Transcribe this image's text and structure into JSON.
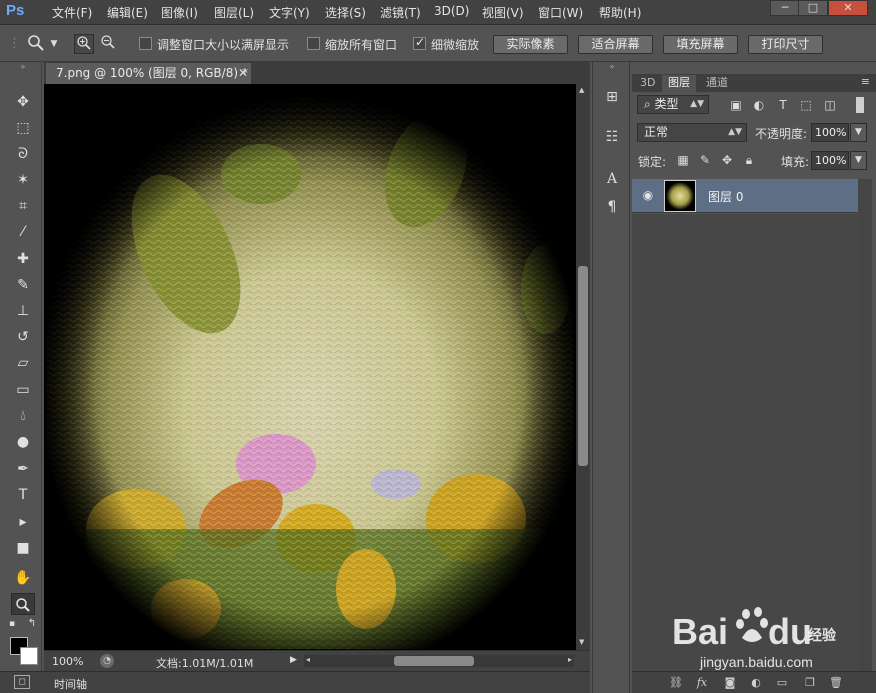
{
  "app": {
    "logo": "Ps",
    "menu": [
      "文件(F)",
      "编辑(E)",
      "图像(I)",
      "图层(L)",
      "文字(Y)",
      "选择(S)",
      "滤镜(T)",
      "3D(D)",
      "视图(V)",
      "窗口(W)",
      "帮助(H)"
    ]
  },
  "options_bar": {
    "tool_icon": "zoom-icon",
    "resize_windows_label": "调整窗口大小以满屏显示",
    "resize_windows_checked": false,
    "zoom_all_windows_label": "缩放所有窗口",
    "zoom_all_windows_checked": false,
    "scrubby_zoom_label": "细微缩放",
    "scrubby_zoom_checked": true,
    "buttons": [
      "实际像素",
      "适合屏幕",
      "填充屏幕",
      "打印尺寸"
    ]
  },
  "document": {
    "tab_title": "7.png @ 100% (图层 0, RGB/8) *",
    "zoom": "100%",
    "doc_info": "文档:1.01M/1.01M",
    "timeline_label": "时间轴"
  },
  "layers_panel": {
    "tabs": [
      "3D",
      "图层",
      "通道"
    ],
    "active_tab": "图层",
    "filter_kind": "类型",
    "blend_mode": "正常",
    "opacity_label": "不透明度:",
    "opacity_value": "100%",
    "lock_label": "锁定:",
    "fill_label": "填充:",
    "fill_value": "100%",
    "layers": [
      {
        "name": "图层 0",
        "visible": true,
        "selected": true
      }
    ]
  },
  "watermark": {
    "brand": "Bai du 经验",
    "domain": "jingyan.baidu.com"
  },
  "colors": {
    "accent_selected_layer": "#5d6e85",
    "foreground": "#000000",
    "background": "#ffffff"
  }
}
